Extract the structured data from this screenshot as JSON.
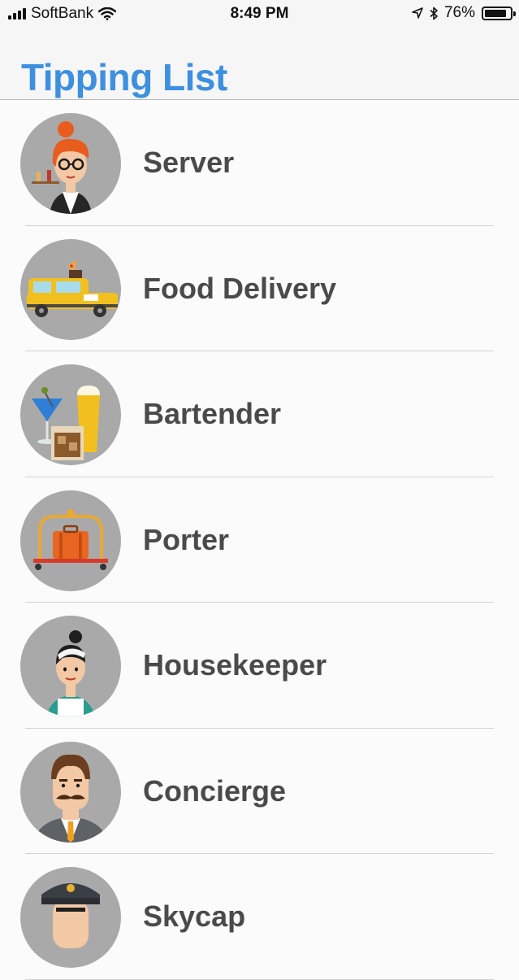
{
  "status_bar": {
    "carrier": "SoftBank",
    "time": "8:49 PM",
    "battery": "76%"
  },
  "header": {
    "title": "Tipping List"
  },
  "list": [
    {
      "label": "Server",
      "icon": "server-avatar-icon"
    },
    {
      "label": "Food Delivery",
      "icon": "food-delivery-avatar-icon"
    },
    {
      "label": "Bartender",
      "icon": "bartender-avatar-icon"
    },
    {
      "label": "Porter",
      "icon": "porter-avatar-icon"
    },
    {
      "label": "Housekeeper",
      "icon": "housekeeper-avatar-icon"
    },
    {
      "label": "Concierge",
      "icon": "concierge-avatar-icon"
    },
    {
      "label": "Skycap",
      "icon": "skycap-avatar-icon"
    }
  ],
  "colors": {
    "title": "#3d8fe0",
    "label": "#4a4a4a",
    "avatar_bg": "#a9a9aa"
  }
}
